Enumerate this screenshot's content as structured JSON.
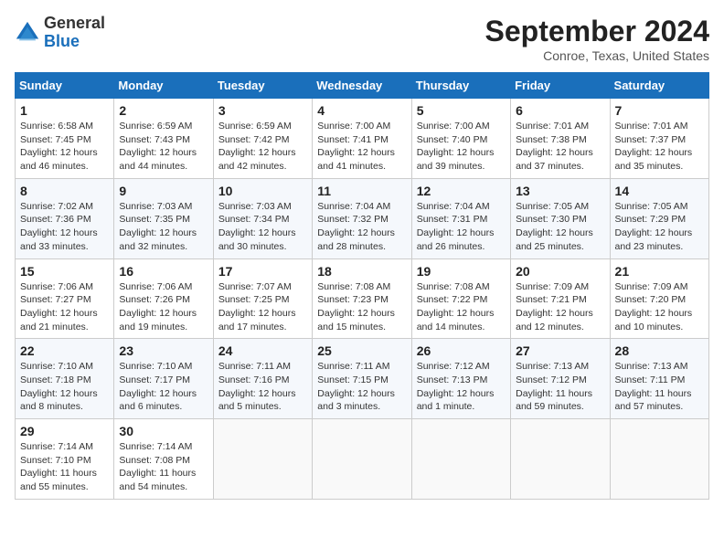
{
  "header": {
    "logo_line1": "General",
    "logo_line2": "Blue",
    "title": "September 2024",
    "location": "Conroe, Texas, United States"
  },
  "columns": [
    "Sunday",
    "Monday",
    "Tuesday",
    "Wednesday",
    "Thursday",
    "Friday",
    "Saturday"
  ],
  "weeks": [
    [
      {
        "day": "1",
        "info": "Sunrise: 6:58 AM\nSunset: 7:45 PM\nDaylight: 12 hours\nand 46 minutes."
      },
      {
        "day": "2",
        "info": "Sunrise: 6:59 AM\nSunset: 7:43 PM\nDaylight: 12 hours\nand 44 minutes."
      },
      {
        "day": "3",
        "info": "Sunrise: 6:59 AM\nSunset: 7:42 PM\nDaylight: 12 hours\nand 42 minutes."
      },
      {
        "day": "4",
        "info": "Sunrise: 7:00 AM\nSunset: 7:41 PM\nDaylight: 12 hours\nand 41 minutes."
      },
      {
        "day": "5",
        "info": "Sunrise: 7:00 AM\nSunset: 7:40 PM\nDaylight: 12 hours\nand 39 minutes."
      },
      {
        "day": "6",
        "info": "Sunrise: 7:01 AM\nSunset: 7:38 PM\nDaylight: 12 hours\nand 37 minutes."
      },
      {
        "day": "7",
        "info": "Sunrise: 7:01 AM\nSunset: 7:37 PM\nDaylight: 12 hours\nand 35 minutes."
      }
    ],
    [
      {
        "day": "8",
        "info": "Sunrise: 7:02 AM\nSunset: 7:36 PM\nDaylight: 12 hours\nand 33 minutes."
      },
      {
        "day": "9",
        "info": "Sunrise: 7:03 AM\nSunset: 7:35 PM\nDaylight: 12 hours\nand 32 minutes."
      },
      {
        "day": "10",
        "info": "Sunrise: 7:03 AM\nSunset: 7:34 PM\nDaylight: 12 hours\nand 30 minutes."
      },
      {
        "day": "11",
        "info": "Sunrise: 7:04 AM\nSunset: 7:32 PM\nDaylight: 12 hours\nand 28 minutes."
      },
      {
        "day": "12",
        "info": "Sunrise: 7:04 AM\nSunset: 7:31 PM\nDaylight: 12 hours\nand 26 minutes."
      },
      {
        "day": "13",
        "info": "Sunrise: 7:05 AM\nSunset: 7:30 PM\nDaylight: 12 hours\nand 25 minutes."
      },
      {
        "day": "14",
        "info": "Sunrise: 7:05 AM\nSunset: 7:29 PM\nDaylight: 12 hours\nand 23 minutes."
      }
    ],
    [
      {
        "day": "15",
        "info": "Sunrise: 7:06 AM\nSunset: 7:27 PM\nDaylight: 12 hours\nand 21 minutes."
      },
      {
        "day": "16",
        "info": "Sunrise: 7:06 AM\nSunset: 7:26 PM\nDaylight: 12 hours\nand 19 minutes."
      },
      {
        "day": "17",
        "info": "Sunrise: 7:07 AM\nSunset: 7:25 PM\nDaylight: 12 hours\nand 17 minutes."
      },
      {
        "day": "18",
        "info": "Sunrise: 7:08 AM\nSunset: 7:23 PM\nDaylight: 12 hours\nand 15 minutes."
      },
      {
        "day": "19",
        "info": "Sunrise: 7:08 AM\nSunset: 7:22 PM\nDaylight: 12 hours\nand 14 minutes."
      },
      {
        "day": "20",
        "info": "Sunrise: 7:09 AM\nSunset: 7:21 PM\nDaylight: 12 hours\nand 12 minutes."
      },
      {
        "day": "21",
        "info": "Sunrise: 7:09 AM\nSunset: 7:20 PM\nDaylight: 12 hours\nand 10 minutes."
      }
    ],
    [
      {
        "day": "22",
        "info": "Sunrise: 7:10 AM\nSunset: 7:18 PM\nDaylight: 12 hours\nand 8 minutes."
      },
      {
        "day": "23",
        "info": "Sunrise: 7:10 AM\nSunset: 7:17 PM\nDaylight: 12 hours\nand 6 minutes."
      },
      {
        "day": "24",
        "info": "Sunrise: 7:11 AM\nSunset: 7:16 PM\nDaylight: 12 hours\nand 5 minutes."
      },
      {
        "day": "25",
        "info": "Sunrise: 7:11 AM\nSunset: 7:15 PM\nDaylight: 12 hours\nand 3 minutes."
      },
      {
        "day": "26",
        "info": "Sunrise: 7:12 AM\nSunset: 7:13 PM\nDaylight: 12 hours\nand 1 minute."
      },
      {
        "day": "27",
        "info": "Sunrise: 7:13 AM\nSunset: 7:12 PM\nDaylight: 11 hours\nand 59 minutes."
      },
      {
        "day": "28",
        "info": "Sunrise: 7:13 AM\nSunset: 7:11 PM\nDaylight: 11 hours\nand 57 minutes."
      }
    ],
    [
      {
        "day": "29",
        "info": "Sunrise: 7:14 AM\nSunset: 7:10 PM\nDaylight: 11 hours\nand 55 minutes."
      },
      {
        "day": "30",
        "info": "Sunrise: 7:14 AM\nSunset: 7:08 PM\nDaylight: 11 hours\nand 54 minutes."
      },
      {
        "day": "",
        "info": ""
      },
      {
        "day": "",
        "info": ""
      },
      {
        "day": "",
        "info": ""
      },
      {
        "day": "",
        "info": ""
      },
      {
        "day": "",
        "info": ""
      }
    ]
  ]
}
